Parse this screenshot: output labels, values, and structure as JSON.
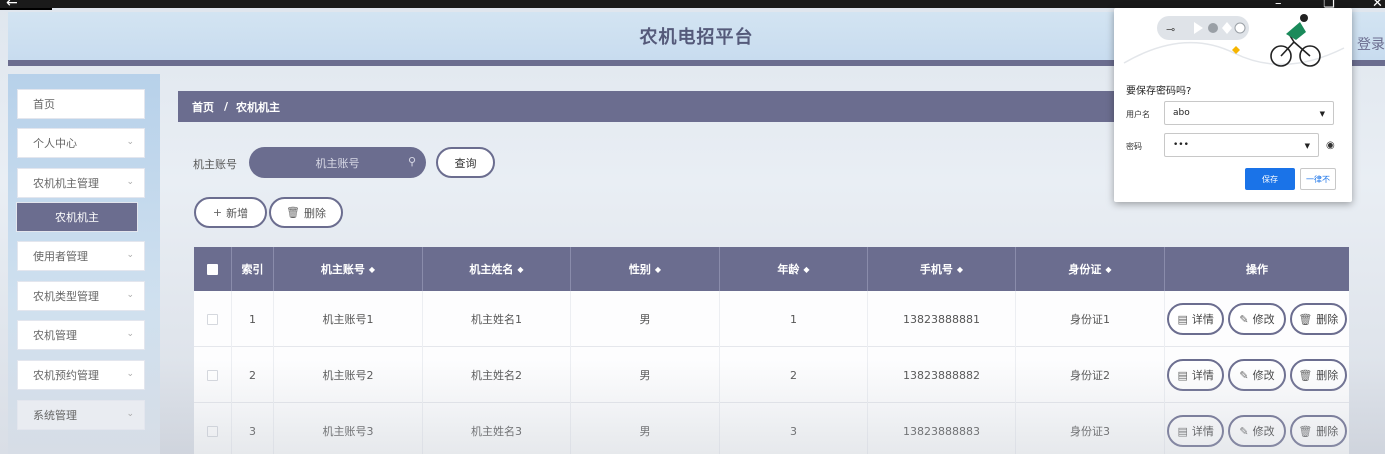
{
  "window": {
    "back_icon": "arrow-left-icon",
    "min_icon": "minimize-icon",
    "max_icon": "maximize-icon",
    "close_icon": "close-icon"
  },
  "header": {
    "title": "农机电招平台",
    "login": "登录"
  },
  "sidebar": {
    "items": [
      {
        "label": "首页",
        "has_chevron": false
      },
      {
        "label": "个人中心",
        "has_chevron": true
      },
      {
        "label": "农机机主管理",
        "has_chevron": true
      },
      {
        "label": "农机机主",
        "has_chevron": false,
        "active": true
      },
      {
        "label": "使用者管理",
        "has_chevron": true
      },
      {
        "label": "农机类型管理",
        "has_chevron": true
      },
      {
        "label": "农机管理",
        "has_chevron": true
      },
      {
        "label": "农机预约管理",
        "has_chevron": true
      },
      {
        "label": "系统管理",
        "has_chevron": true
      }
    ]
  },
  "breadcrumb": {
    "home": "首页",
    "separator": "/",
    "current": "农机机主"
  },
  "search": {
    "label": "机主账号",
    "placeholder": "机主账号",
    "button": "查询"
  },
  "actions": {
    "add": "新增",
    "add_icon": "plus-icon",
    "delete": "删除",
    "delete_icon": "trash-icon"
  },
  "table": {
    "columns": [
      "索引",
      "机主账号",
      "机主姓名",
      "性别",
      "年龄",
      "手机号",
      "身份证",
      "操作"
    ],
    "sortable": [
      "机主账号",
      "机主姓名",
      "性别",
      "年龄",
      "手机号",
      "身份证"
    ],
    "rows": [
      {
        "index": "1",
        "account": "机主账号1",
        "name": "机主姓名1",
        "gender": "男",
        "age": "1",
        "phone": "13823888881",
        "id_card": "身份证1"
      },
      {
        "index": "2",
        "account": "机主账号2",
        "name": "机主姓名2",
        "gender": "男",
        "age": "2",
        "phone": "13823888882",
        "id_card": "身份证2"
      },
      {
        "index": "3",
        "account": "机主账号3",
        "name": "机主姓名3",
        "gender": "男",
        "age": "3",
        "phone": "13823888883",
        "id_card": "身份证3"
      }
    ],
    "row_actions": {
      "detail": "详情",
      "edit": "修改",
      "delete": "删除"
    }
  },
  "password_popup": {
    "title": "要保存密码吗?",
    "username_label": "用户名",
    "username_value": "abo",
    "password_label": "密码",
    "password_value": "•••",
    "save": "保存",
    "never": "一律不"
  },
  "colors": {
    "accent": "#6b6d8f",
    "header_bg": "#c8dcef",
    "save_blue": "#1a73e8"
  }
}
